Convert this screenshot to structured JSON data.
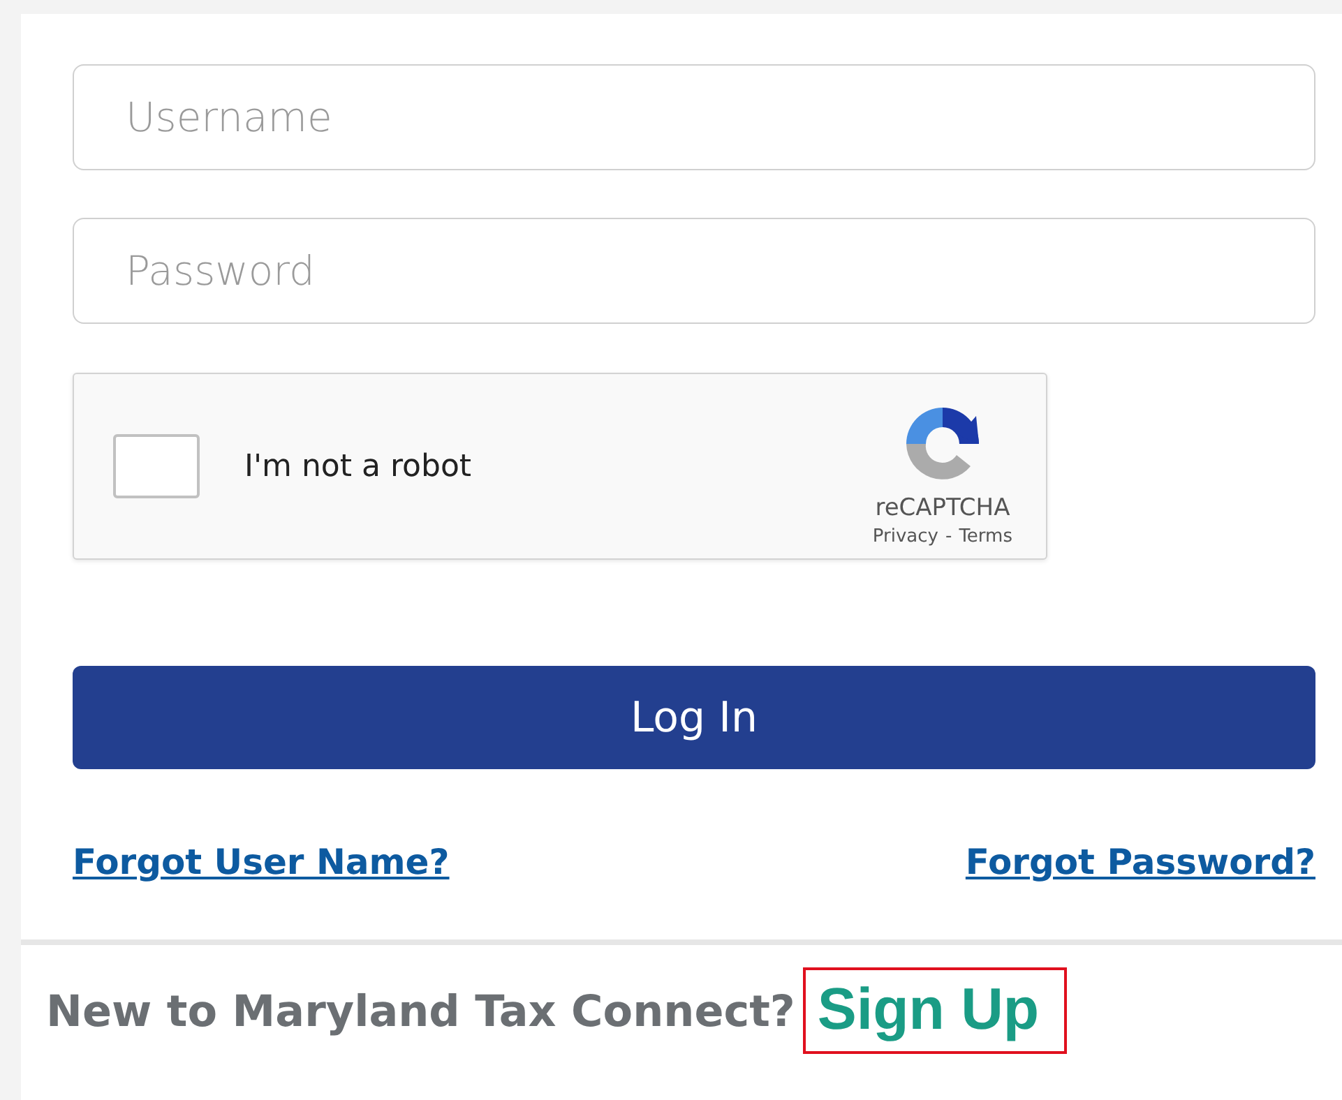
{
  "login_form": {
    "username": {
      "placeholder": "Username"
    },
    "password": {
      "placeholder": "Password"
    },
    "captcha": {
      "label": "I'm not a robot",
      "checked": false,
      "brand": "reCAPTCHA",
      "privacy": "Privacy",
      "separator": "-",
      "terms": "Terms"
    },
    "login_button": "Log In",
    "links": [
      "Forgot User Name?",
      "Forgot Password?"
    ]
  },
  "signup": {
    "prompt": "New to Maryland Tax Connect?",
    "link": "Sign Up",
    "highlighted": true
  }
}
